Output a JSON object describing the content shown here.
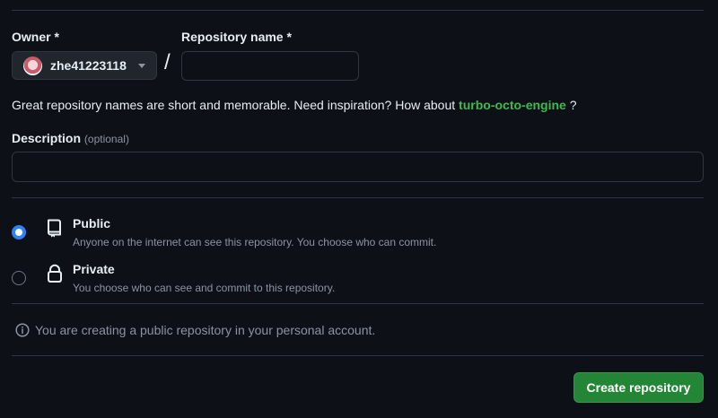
{
  "form": {
    "owner_label": "Owner *",
    "owner_value": "zhe41223118",
    "repo_label": "Repository name *",
    "repo_value": "",
    "slash": "/",
    "hint_prefix": "Great repository names are short and memorable. Need inspiration? How about ",
    "hint_suggestion": "turbo-octo-engine",
    "hint_suffix": " ?",
    "description_label": "Description",
    "description_optional": "(optional)",
    "description_value": ""
  },
  "visibility": {
    "selected": "public",
    "options": [
      {
        "title": "Public",
        "description": "Anyone on the internet can see this repository. You choose who can commit.",
        "icon": "repo-icon"
      },
      {
        "title": "Private",
        "description": "You choose who can see and commit to this repository.",
        "icon": "lock-icon"
      }
    ]
  },
  "notice": {
    "text": "You are creating a public repository in your personal account.",
    "icon": "info-icon"
  },
  "actions": {
    "create_label": "Create repository"
  },
  "colors": {
    "background": "#0d1117",
    "accent_blue": "#2f81f7",
    "accent_green": "#3fb950",
    "button_green": "#238636",
    "muted_text": "#8b949e",
    "border": "#30363d"
  }
}
